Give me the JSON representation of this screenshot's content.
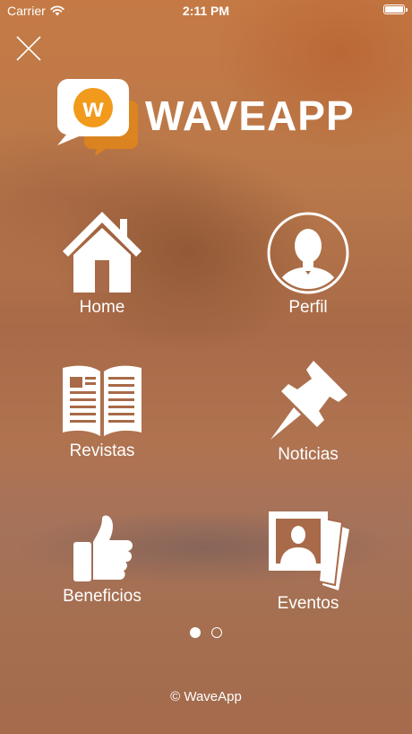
{
  "status_bar": {
    "carrier": "Carrier",
    "time": "2:11 PM",
    "battery_level": 1.0
  },
  "brand": {
    "name": "WAVEAPP",
    "logo_letter": "w",
    "accent_color": "#f29a1b"
  },
  "menu": {
    "items": [
      {
        "label": "Home",
        "icon": "home-icon"
      },
      {
        "label": "Perfil",
        "icon": "profile-icon"
      },
      {
        "label": "Revistas",
        "icon": "magazine-icon"
      },
      {
        "label": "Noticias",
        "icon": "pushpin-icon"
      },
      {
        "label": "Beneficios",
        "icon": "thumbs-up-icon"
      },
      {
        "label": "Eventos",
        "icon": "photos-icon"
      }
    ]
  },
  "pager": {
    "current_page": 1,
    "total_pages": 2
  },
  "footer": {
    "copyright": "© WaveApp"
  }
}
